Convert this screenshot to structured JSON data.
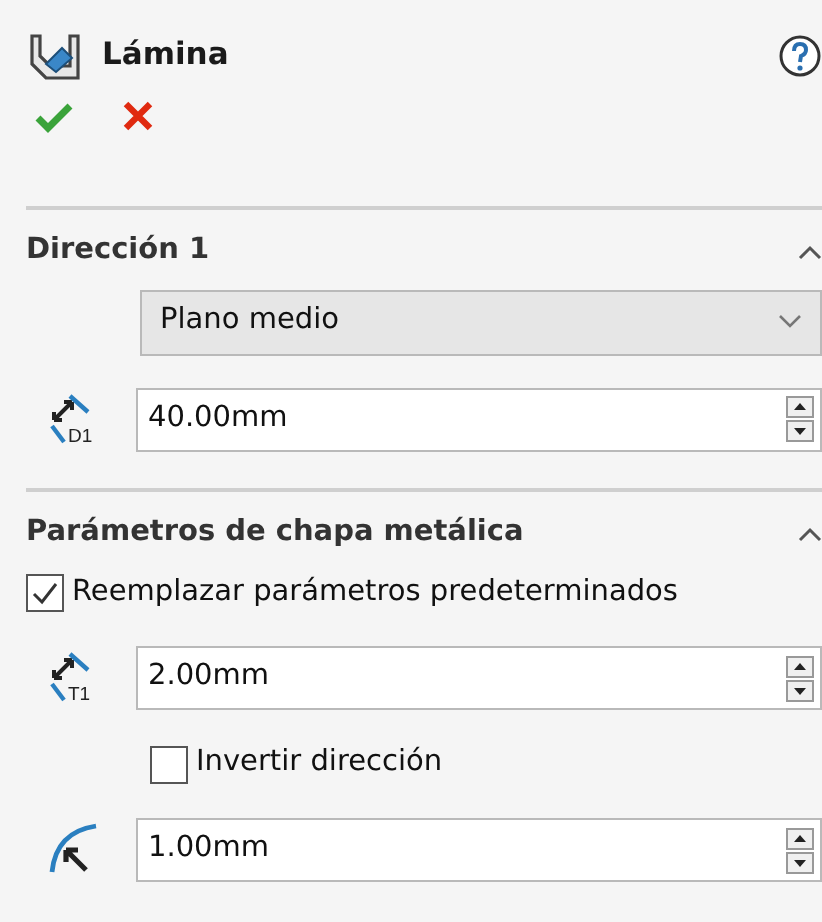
{
  "panel": {
    "title": "Lámina",
    "actions": [
      {
        "kind": "ok"
      },
      {
        "kind": "cancel"
      }
    ]
  },
  "sections": [
    {
      "title": "Dirección 1",
      "expanded": true,
      "controls": [
        {
          "kind": "dropdown",
          "value": "Plano medio"
        },
        {
          "kind": "dimension",
          "icon_label": "D1",
          "value": "40.00mm"
        }
      ]
    },
    {
      "title": "Parámetros de chapa metálica",
      "expanded": true,
      "controls": [
        {
          "kind": "checkbox",
          "label": "Reemplazar parámetros predeterminados",
          "checked": true
        },
        {
          "kind": "dimension",
          "icon_label": "T1",
          "value": "2.00mm"
        },
        {
          "kind": "suboption",
          "label": "Invertir dirección",
          "checked": false
        },
        {
          "kind": "radius",
          "value": "1.00mm"
        }
      ]
    }
  ]
}
